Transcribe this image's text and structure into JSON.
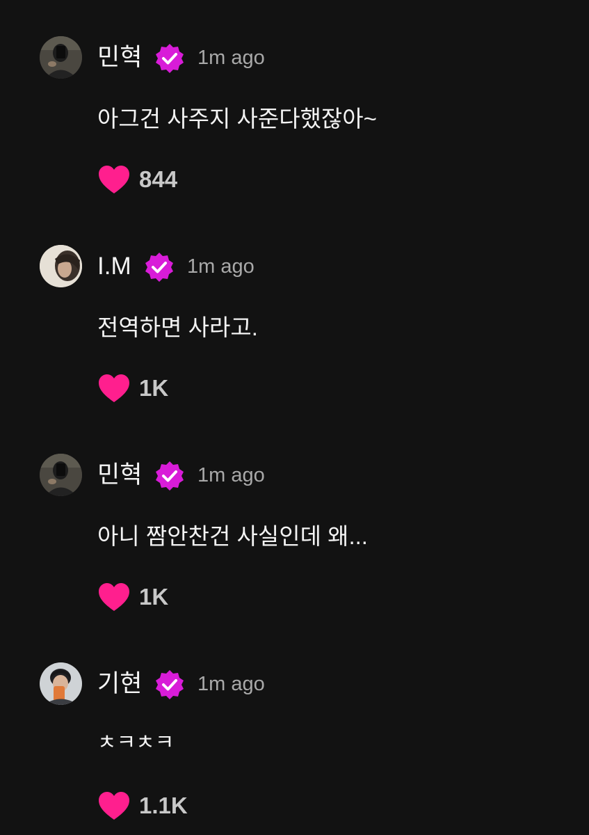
{
  "colors": {
    "background": "#121212",
    "heart": "#ff1f8e",
    "badge_fill": "#d81cd8",
    "text_primary": "#f3f3f3",
    "text_secondary": "#a9a9a9"
  },
  "comments": [
    {
      "author": "민혁",
      "time": "1m ago",
      "text": "아그건 사주지 사준다했잖아~",
      "likes": "844",
      "verified": true,
      "avatar": "avatar-minhyuk"
    },
    {
      "author": "I.M",
      "time": "1m ago",
      "text": "전역하면 사라고.",
      "likes": "1K",
      "verified": true,
      "avatar": "avatar-im"
    },
    {
      "author": "민혁",
      "time": "1m ago",
      "text": "아니 짬안찬건 사실인데 왜...",
      "likes": "1K",
      "verified": true,
      "avatar": "avatar-minhyuk"
    },
    {
      "author": "기현",
      "time": "1m ago",
      "text": "ㅊㅋㅊㅋ",
      "likes": "1.1K",
      "verified": true,
      "avatar": "avatar-kihyun"
    }
  ],
  "icons": {
    "verified": "verified-badge-icon",
    "like": "heart-icon"
  }
}
